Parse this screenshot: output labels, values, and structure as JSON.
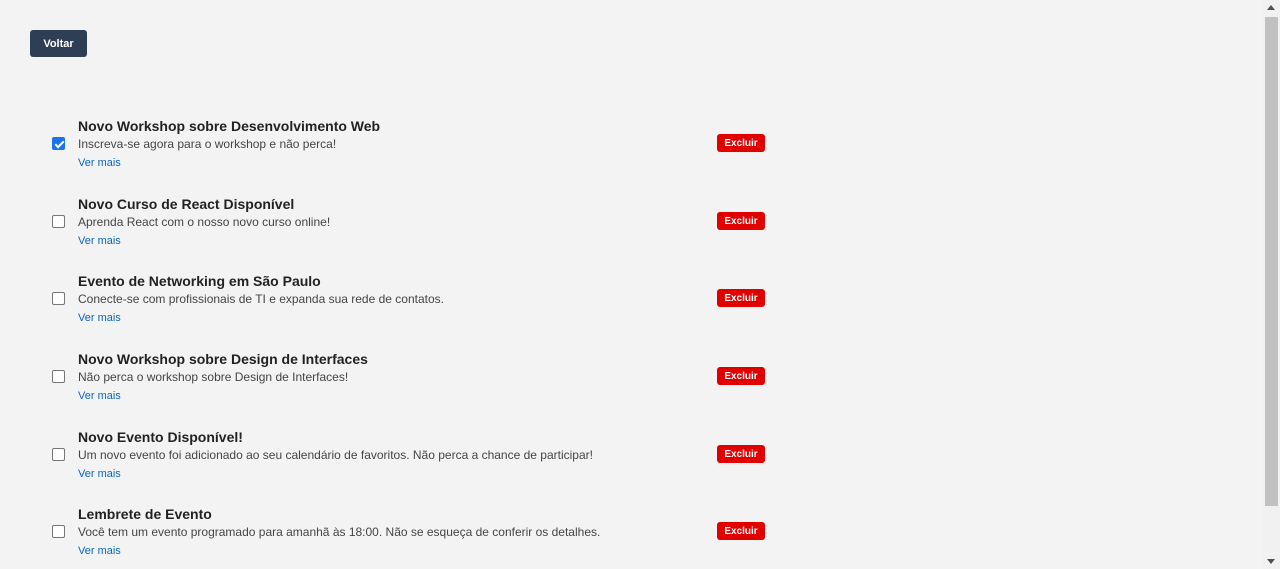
{
  "header": {
    "back_label": "Voltar"
  },
  "notifications": [
    {
      "title": "Novo Workshop sobre Desenvolvimento Web",
      "description": "Inscreva-se agora para o workshop e não perca!",
      "more_label": "Ver mais",
      "delete_label": "Excluir",
      "checked": true
    },
    {
      "title": "Novo Curso de React Disponível",
      "description": "Aprenda React com o nosso novo curso online!",
      "more_label": "Ver mais",
      "delete_label": "Excluir",
      "checked": false
    },
    {
      "title": "Evento de Networking em São Paulo",
      "description": "Conecte-se com profissionais de TI e expanda sua rede de contatos.",
      "more_label": "Ver mais",
      "delete_label": "Excluir",
      "checked": false
    },
    {
      "title": "Novo Workshop sobre Design de Interfaces",
      "description": "Não perca o workshop sobre Design de Interfaces!",
      "more_label": "Ver mais",
      "delete_label": "Excluir",
      "checked": false
    },
    {
      "title": "Novo Evento Disponível!",
      "description": "Um novo evento foi adicionado ao seu calendário de favoritos. Não perca a chance de participar!",
      "more_label": "Ver mais",
      "delete_label": "Excluir",
      "checked": false
    },
    {
      "title": "Lembrete de Evento",
      "description": "Você tem um evento programado para amanhã às 18:00. Não se esqueça de conferir os detalhes.",
      "more_label": "Ver mais",
      "delete_label": "Excluir",
      "checked": false
    }
  ],
  "colors": {
    "back_button": "#2e3e55",
    "delete_button": "#e00000",
    "link": "#0a66c2",
    "checkbox_checked": "#1a73e8",
    "background": "#f3f3f4"
  }
}
